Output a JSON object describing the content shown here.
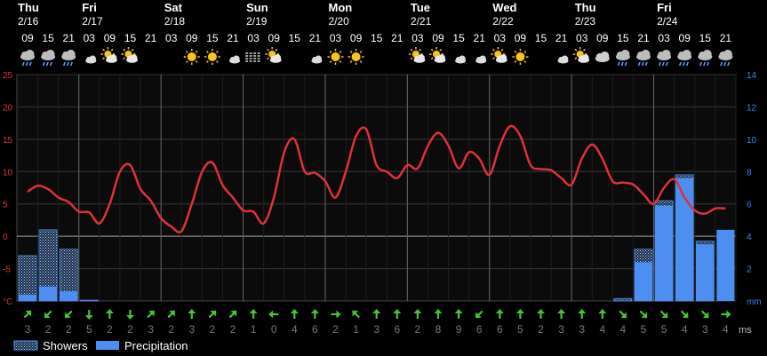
{
  "chart_data": {
    "type": "line+bar",
    "days": [
      {
        "name": "Thu",
        "date": "2/16"
      },
      {
        "name": "Fri",
        "date": "2/17"
      },
      {
        "name": "Sat",
        "date": "2/18"
      },
      {
        "name": "Sun",
        "date": "2/19"
      },
      {
        "name": "Mon",
        "date": "2/20"
      },
      {
        "name": "Tue",
        "date": "2/21"
      },
      {
        "name": "Wed",
        "date": "2/22"
      },
      {
        "name": "Thu",
        "date": "2/23"
      },
      {
        "name": "Fri",
        "date": "2/24"
      }
    ],
    "hours": [
      "09",
      "15",
      "21",
      "03",
      "09",
      "15",
      "21",
      "03",
      "09",
      "15",
      "21",
      "03",
      "09",
      "15",
      "21",
      "03",
      "09",
      "15",
      "21",
      "03",
      "09",
      "15",
      "21",
      "03",
      "09",
      "15",
      "21",
      "03",
      "09",
      "15",
      "21",
      "03",
      "09",
      "15",
      "21"
    ],
    "icons": [
      "cloud-rain",
      "cloud-rain",
      "cloud-rain",
      "moon-cloud",
      "sun-cloud",
      "sun-cloud",
      "moon",
      "moon",
      "sun",
      "sun",
      "moon-cloud",
      "fog",
      "sun-cloud",
      "moon",
      "moon-cloud",
      "sun",
      "sun",
      "moon",
      "moon",
      "sun-cloud",
      "sun-cloud",
      "moon-cloud",
      "moon-cloud",
      "sun-cloud",
      "sun",
      "moon",
      "moon-cloud",
      "sun-cloud",
      "cloud",
      "cloud-rain",
      "cloud-rain",
      "cloud-rain",
      "cloud-rain",
      "cloud-rain",
      "cloud-rain"
    ],
    "temperature": {
      "unit": "°C",
      "ylim": [
        -10,
        25
      ],
      "ticks": [
        25,
        20,
        15,
        10,
        5,
        0,
        -5
      ],
      "x": [
        0,
        0.5,
        1,
        1.5,
        2,
        2.5,
        3,
        3.5,
        4,
        4.5,
        5,
        5.5,
        6,
        6.5,
        7,
        7.5,
        8,
        8.5,
        9,
        9.5,
        10,
        10.5,
        11,
        11.5,
        12,
        12.5,
        13,
        13.5,
        14,
        14.5,
        15,
        15.5,
        16,
        16.5,
        17,
        17.5,
        18,
        18.5,
        19,
        19.5,
        20,
        20.5,
        21,
        21.5,
        22,
        22.5,
        23,
        23.5,
        24,
        24.5,
        25,
        25.5,
        26,
        26.5,
        27,
        27.5,
        28,
        28.5,
        29,
        29.5,
        30,
        30.5,
        31,
        31.5,
        32,
        32.5,
        33,
        33.5,
        34
      ],
      "values": [
        6.9,
        7.8,
        7.3,
        6.0,
        5.3,
        3.8,
        3.7,
        2.0,
        5.0,
        10.0,
        11.0,
        7.3,
        5.5,
        2.8,
        1.5,
        0.8,
        5.0,
        10.0,
        11.4,
        7.9,
        6.0,
        4.0,
        3.8,
        2.0,
        6.0,
        13.0,
        15.0,
        10.0,
        9.8,
        8.5,
        6.0,
        10.0,
        15.5,
        16.5,
        11.0,
        10.0,
        9.0,
        11.0,
        10.5,
        14.0,
        16.0,
        14.0,
        10.5,
        13.0,
        12.0,
        9.5,
        14.0,
        17.0,
        15.5,
        11.0,
        10.4,
        10.2,
        9.0,
        8.0,
        12.0,
        14.2,
        12.0,
        8.5,
        8.3,
        8.0,
        6.5,
        5.0,
        7.5,
        8.8,
        6.0,
        4.0,
        3.5,
        4.3,
        4.3
      ]
    },
    "precipitation": {
      "unit": "mm",
      "ylim": [
        0,
        14
      ],
      "ticks": [
        14,
        12,
        10,
        8,
        6,
        4,
        2
      ],
      "showers": [
        2.8,
        4.4,
        3.2,
        0.05,
        0,
        0,
        0,
        0,
        0,
        0,
        0,
        0,
        0,
        0,
        0,
        0,
        0,
        0,
        0,
        0,
        0,
        0,
        0,
        0,
        0,
        0,
        0,
        0,
        0,
        0.15,
        3.2,
        6.2,
        7.8,
        3.7,
        0
      ],
      "precipitation": [
        0.4,
        0.9,
        0.6,
        0,
        0,
        0,
        0,
        0,
        0,
        0,
        0,
        0,
        0,
        0,
        0,
        0,
        0,
        0,
        0,
        0,
        0,
        0,
        0,
        0,
        0,
        0,
        0,
        0,
        0,
        0,
        2.4,
        5.9,
        7.6,
        3.5,
        4.4
      ]
    },
    "wind": {
      "unit": "ms",
      "directions": [
        "NE",
        "SW",
        "SW",
        "S",
        "N",
        "S",
        "NE",
        "NE",
        "N",
        "NE",
        "NE",
        "N",
        "W",
        "N",
        "N",
        "E",
        "NW",
        "N",
        "N",
        "N",
        "N",
        "N",
        "SW",
        "N",
        "N",
        "N",
        "N",
        "N",
        "N",
        "SE",
        "SE",
        "SE",
        "SE",
        "SE",
        "E"
      ],
      "speeds": [
        "3",
        "2",
        "2",
        "5",
        "2",
        "2",
        "3",
        "2",
        "3",
        "2",
        "2",
        "1",
        "0",
        "4",
        "6",
        "2",
        "1",
        "3",
        "6",
        "2",
        "8",
        "9",
        "6",
        "6",
        "5",
        "2",
        "3",
        "3",
        "4",
        "4",
        "5",
        "5",
        "4",
        "3",
        "4"
      ]
    },
    "legend": [
      "Showers",
      "Precipitation"
    ]
  },
  "colors": {
    "temperature": "#e0303a",
    "precipitation": "#4d8ff0",
    "showers": "#a6c8f4",
    "wind_arrow": "#49c23a",
    "grid": "#2a2a2a",
    "day_separator": "#666666",
    "zero_line": "#8a8a8a"
  }
}
